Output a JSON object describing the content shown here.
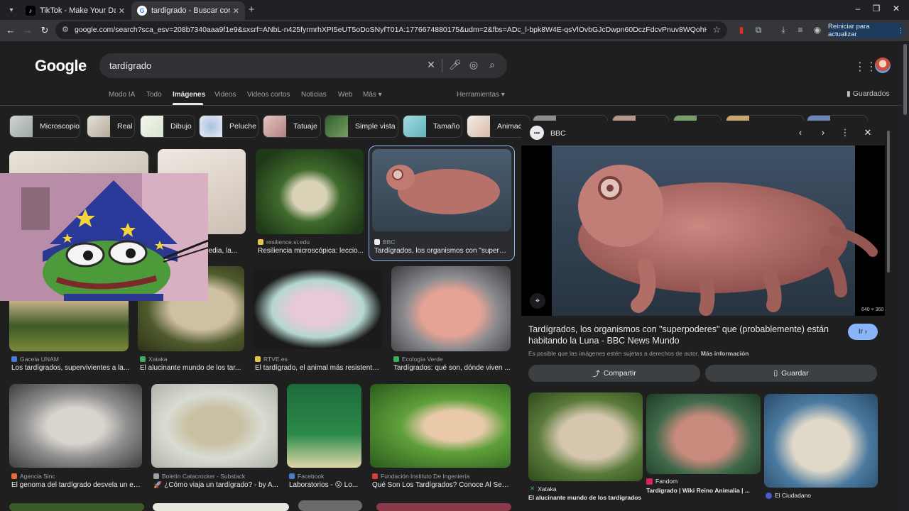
{
  "browser": {
    "tabs": [
      {
        "label": "TikTok - Make Your Day",
        "active": false
      },
      {
        "label": "tardigrado - Buscar con Google",
        "active": true
      }
    ],
    "url": "google.com/search?sca_esv=208b7340aaa9f1e9&sxsrf=ANbL-n425fyrmrhXPI5eUT5oDoSNyfT01A:1776674880175&udm=2&fbs=ADc_l-bpk8W4E-qsVlOvbGJcDwpn60DczFdcvPnuv8WQohHLTaf9fS4tU71bi2aHS-Pmeg...",
    "restart_label": "Reiniciar para actualizar"
  },
  "google": {
    "logo": "Google",
    "query": "tardígrado",
    "tabs": [
      "Modo IA",
      "Todo",
      "Imágenes",
      "Videos",
      "Videos cortos",
      "Noticias",
      "Web",
      "Más ▾"
    ],
    "active_tab": "Imágenes",
    "tools_label": "Herramientas ▾",
    "saved_label": "Guardados"
  },
  "chips": [
    "Microscopio",
    "Real",
    "Dibujo",
    "Peluche",
    "Tatuaje",
    "Simple vista",
    "Tamaño",
    "Animado"
  ],
  "results": [
    {
      "source": "",
      "title": ""
    },
    {
      "source": "",
      "title": "pedia, la..."
    },
    {
      "source": "resilience.si.edu",
      "title": "Resiliencia microscópica: leccio..."
    },
    {
      "source": "BBC",
      "title": "Tardígrados, los organismos con \"superpo..."
    },
    {
      "source": "Gaceta UNAM",
      "title": "Los tardígrados, supervivientes a la..."
    },
    {
      "source": "Xataka",
      "title": "El alucinante mundo de los tar..."
    },
    {
      "source": "RTVE.es",
      "title": "El tardígrado, el animal más resistente ..."
    },
    {
      "source": "Ecología Verde",
      "title": "Tardígrados: qué son, dónde viven ..."
    },
    {
      "source": "Agencia Sinc",
      "title": "El genoma del tardígrado desvela un es..."
    },
    {
      "source": "Boletín Catacrocker - Substack",
      "title": "🚀 ¿Cómo viaja un tardígrado? - by A..."
    },
    {
      "source": "Facebook",
      "title": "Laboratorios - 😮 Lo..."
    },
    {
      "source": "Fundación Instituto De Ingeniería",
      "title": "Qué Son Los Tardígrados? Conoce Al Ser ..."
    }
  ],
  "panel": {
    "source": "BBC",
    "title": "Tardígrados, los organismos con \"superpoderes\" que (probablemente) están habitando la Luna - BBC News Mundo",
    "go_label": "Ir ›",
    "dims": "640 × 360",
    "copyright": "Es posible que las imágenes estén sujetas a derechos de autor.",
    "more_info": "Más información",
    "share_label": "Compartir",
    "save_label": "Guardar",
    "related": [
      {
        "source": "Xataka",
        "title": "El alucinante mundo de los tardígrados"
      },
      {
        "source": "Fandom",
        "title": "Tardígrado | Wiki Reino Animalia | ..."
      },
      {
        "source": "El Ciudadano",
        "title": ""
      }
    ]
  },
  "colors": {
    "background": "#1f1f1f",
    "accent": "#8ab4f8",
    "text": "#e8eaed",
    "muted": "#9aa0a6"
  }
}
